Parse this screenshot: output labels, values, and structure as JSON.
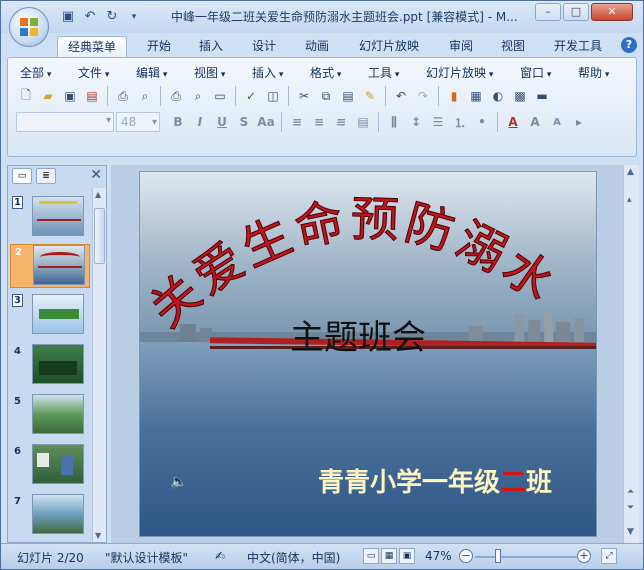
{
  "window": {
    "title": "中峰一年级二班关爱生命预防溺水主题班会.ppt [兼容模式] - M...",
    "controls": {
      "minimize": "–",
      "maximize": "□",
      "close": "✕"
    }
  },
  "quick_access": [
    "save-icon",
    "undo-icon",
    "redo-icon",
    "customize-icon"
  ],
  "ribbon_tabs": [
    "经典菜单",
    "开始",
    "插入",
    "设计",
    "动画",
    "幻灯片放映",
    "审阅",
    "视图",
    "开发工具"
  ],
  "menus": [
    "全部",
    "文件",
    "编辑",
    "视图",
    "插入",
    "格式",
    "工具",
    "幻灯片放映",
    "窗口",
    "帮助"
  ],
  "font": {
    "name": "",
    "size": "48"
  },
  "slide_pane": {
    "slides": [
      "1",
      "2",
      "3",
      "4",
      "5",
      "6",
      "7"
    ],
    "selected": "2"
  },
  "slide": {
    "title": "关爱生命预防溺水",
    "subtitle": "主题班会",
    "class_prefix": "青青小学一年级",
    "class_num": "二",
    "class_suffix": "班"
  },
  "status": {
    "slide": "幻灯片 2/20",
    "theme": "\"默认设计模板\"",
    "language": "中文(简体，中国)",
    "zoom": "47%"
  },
  "colors": {
    "accent": "#c8452f",
    "title_red": "#c0141e",
    "ribbon": "#dae6f4"
  }
}
